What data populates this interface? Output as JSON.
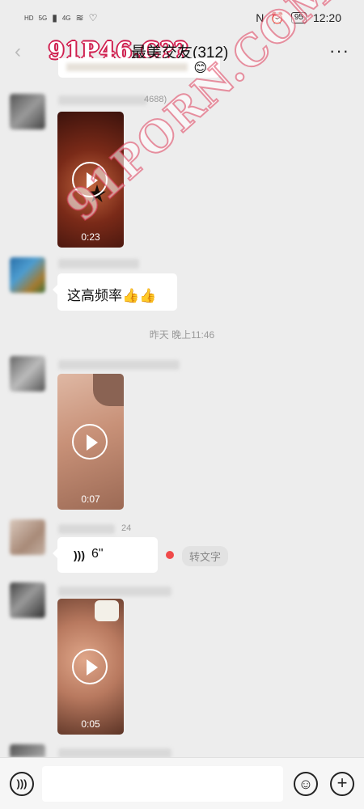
{
  "status_bar": {
    "left_labels": [
      "HD",
      "5G",
      "4G"
    ],
    "time": "12:20",
    "battery": "95"
  },
  "header": {
    "title": "最美交友(312)",
    "watermark": "91P46.C??",
    "more": "···",
    "back": "‹"
  },
  "messages": {
    "m1_name_suffix": "4688)",
    "video1_duration": "0:23",
    "m2_text": "这高频率👍👍",
    "divider_time": "昨天 晚上11:46",
    "video2_duration": "0:07",
    "m3_name_suffix": "24",
    "voice_duration": "6\"",
    "to_text_label": "转文字",
    "video3_duration": "0:05"
  },
  "watermark_diag": "91PORN.COM",
  "input_bar": {
    "voice_icon": "voice-icon",
    "emoji_icon": "emoji-icon",
    "plus_icon": "plus-icon"
  }
}
